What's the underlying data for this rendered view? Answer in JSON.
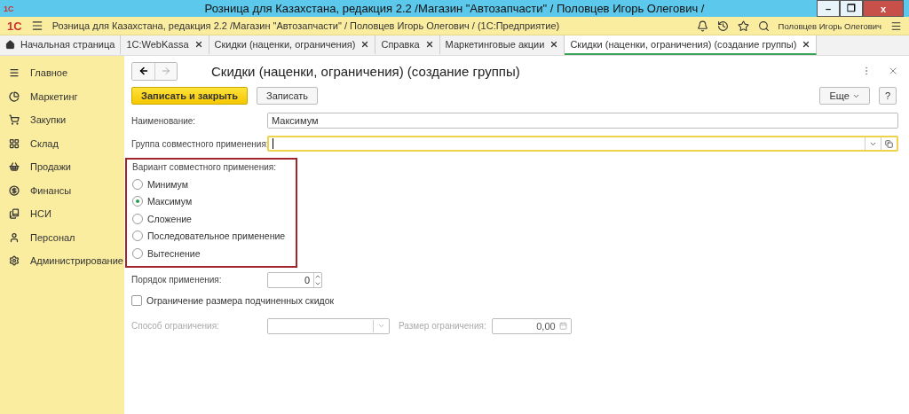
{
  "window": {
    "logo": "1С",
    "title": "Розница для Казахстана, редакция 2.2 /Магазин \"Автозапчасти\" / Половцев Игорь Олегович /",
    "controls": [
      "–",
      "❐",
      "x"
    ]
  },
  "app_bar": {
    "logo": "1С",
    "path": "Розница для Казахстана, редакция 2.2 /Магазин \"Автозапчасти\" / Половцев Игорь Олегович /  (1С:Предприятие)",
    "user": "Половцев Игорь Олегович"
  },
  "tabs": [
    {
      "label": "Начальная страница",
      "selected": false,
      "kind": "home"
    },
    {
      "label": "1С:WebKassa",
      "selected": false,
      "kind": "doc"
    },
    {
      "label": "Скидки (наценки, ограничения)",
      "selected": false,
      "kind": "doc"
    },
    {
      "label": "Справка",
      "selected": false,
      "kind": "doc"
    },
    {
      "label": "Маркетинговые акции",
      "selected": false,
      "kind": "doc"
    },
    {
      "label": "Скидки (наценки, ограничения) (создание группы)",
      "selected": true,
      "kind": "doc"
    }
  ],
  "sidebar": {
    "items": [
      {
        "label": "Главное"
      },
      {
        "label": "Маркетинг"
      },
      {
        "label": "Закупки"
      },
      {
        "label": "Склад"
      },
      {
        "label": "Продажи"
      },
      {
        "label": "Финансы"
      },
      {
        "label": "НСИ"
      },
      {
        "label": "Персонал"
      },
      {
        "label": "Администрирование"
      }
    ]
  },
  "form": {
    "title": "Скидки (наценки, ограничения) (создание группы)",
    "buttons": {
      "save_close": "Записать и закрыть",
      "save": "Записать",
      "more": "Еще",
      "help": "?"
    },
    "name": {
      "label": "Наименование:",
      "value": "Максимум"
    },
    "group": {
      "label": "Группа совместного применения:",
      "focused": true
    },
    "variant": {
      "label": "Вариант совместного применения:",
      "options": [
        {
          "label": "Минимум",
          "selected": false
        },
        {
          "label": "Максимум",
          "selected": true
        },
        {
          "label": "Сложение",
          "selected": false
        },
        {
          "label": "Последовательное применение",
          "selected": false
        },
        {
          "label": "Вытеснение",
          "selected": false
        }
      ]
    },
    "order": {
      "label": "Порядок применения:",
      "value": "0"
    },
    "limit": {
      "label": "Ограничение размера подчиненных скидок",
      "checked": false
    },
    "method": {
      "label": "Способ ограничения:",
      "disabled": true
    },
    "size": {
      "label": "Размер ограничения:",
      "value": "0,00",
      "disabled": true
    }
  }
}
